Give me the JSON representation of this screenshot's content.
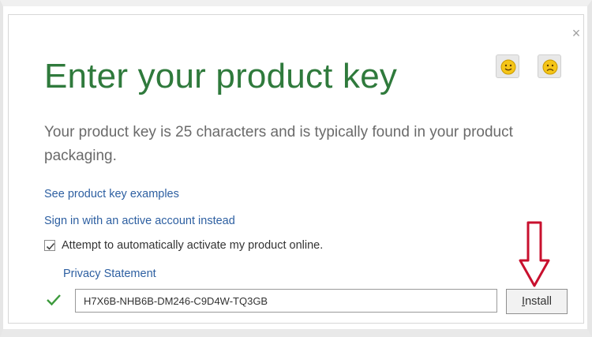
{
  "dialog": {
    "close_glyph": "×",
    "title": "Enter your product key",
    "description": "Your product key is 25 characters and is typically found in your product packaging.",
    "links": {
      "examples": "See product key examples",
      "sign_in": "Sign in with an active account instead",
      "privacy": "Privacy Statement"
    },
    "auto_activate": {
      "label": "Attempt to automatically activate my product online.",
      "checked": true
    },
    "product_key": {
      "value": "H7X6B-NHB6B-DM246-C9D4W-TQ3GB",
      "valid": true
    },
    "install": {
      "mnemonic": "I",
      "rest": "nstall"
    },
    "feedback": {
      "happy_icon": "smile-face-icon",
      "sad_icon": "frown-face-icon"
    }
  },
  "colors": {
    "title_green": "#2f7a3c",
    "link_blue": "#2d5fa1",
    "annotation_red": "#c8102e",
    "check_green": "#3c9a3c"
  }
}
